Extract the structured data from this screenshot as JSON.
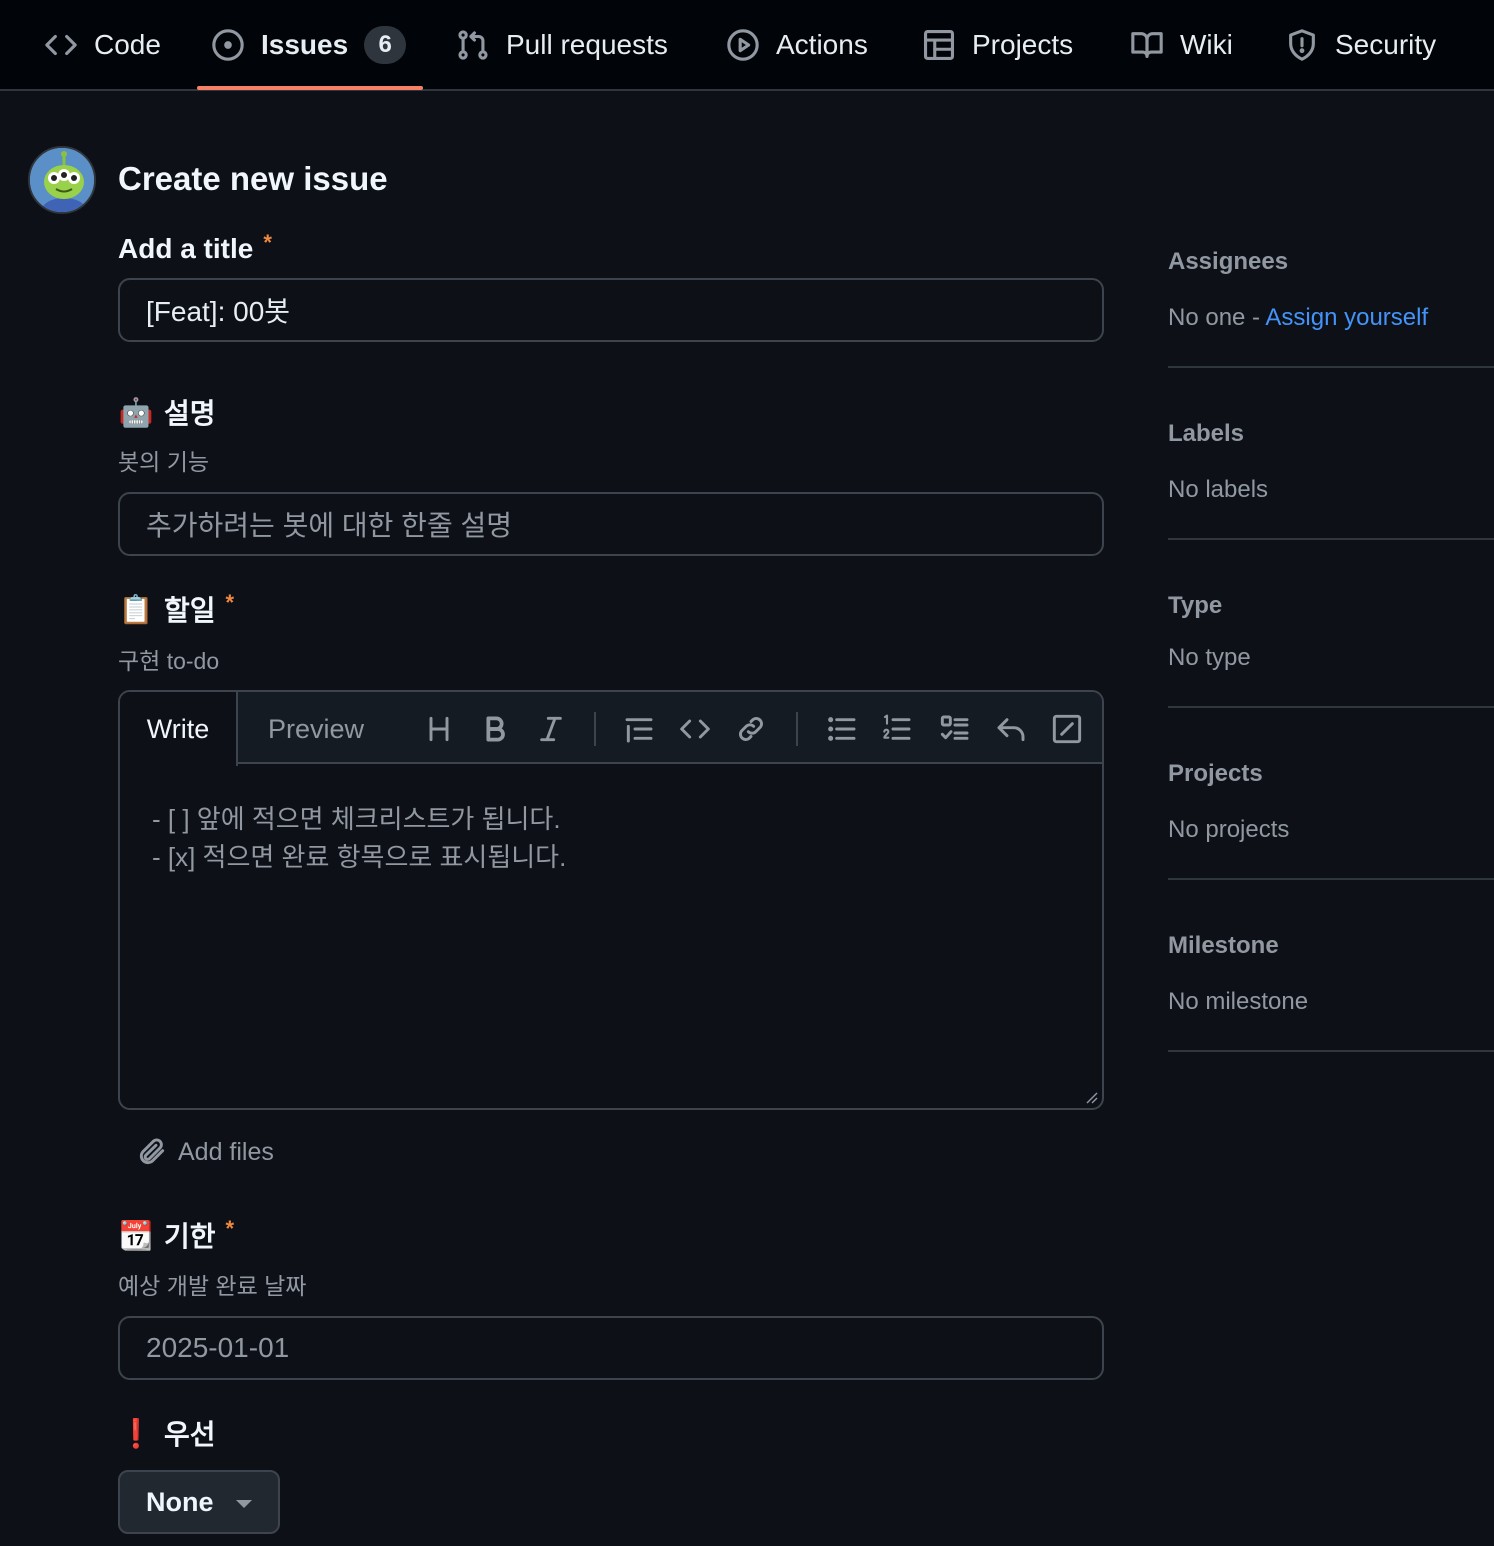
{
  "nav": {
    "tabs": [
      {
        "label": "Code",
        "icon": "code-icon"
      },
      {
        "label": "Issues",
        "icon": "issue-opened-icon",
        "count": "6"
      },
      {
        "label": "Pull requests",
        "icon": "git-pull-request-icon"
      },
      {
        "label": "Actions",
        "icon": "play-icon"
      },
      {
        "label": "Projects",
        "icon": "table-icon"
      },
      {
        "label": "Wiki",
        "icon": "book-icon"
      },
      {
        "label": "Security",
        "icon": "shield-icon"
      }
    ],
    "active_tab": "Issues",
    "active_color": "#f78166"
  },
  "header": {
    "title": "Create new issue"
  },
  "form": {
    "title_field": {
      "label": "Add a title",
      "required_mark": "*",
      "value": "[Feat]: 00봇"
    },
    "description_field": {
      "emoji": "🤖",
      "label": "설명",
      "hint": "봇의 기능",
      "placeholder": "추가하려는 봇에 대한 한줄 설명"
    },
    "todo_field": {
      "emoji": "📋",
      "label": "할일",
      "required_mark": "*",
      "hint": "구현 to-do",
      "write_tab": "Write",
      "preview_tab": "Preview",
      "toolbar_icons": [
        "heading-icon",
        "bold-icon",
        "italic-icon",
        "quote-icon",
        "code-icon",
        "link-icon",
        "unordered-list-icon",
        "ordered-list-icon",
        "tasklist-icon",
        "reply-icon",
        "fullscreen-icon"
      ],
      "placeholder": "- [ ] 앞에 적으면 체크리스트가 됩니다.\n- [x] 적으면 완료 항목으로 표시됩니다.",
      "add_files": "Add files"
    },
    "deadline_field": {
      "emoji": "📆",
      "label": "기한",
      "required_mark": "*",
      "hint": "예상 개발 완료 날짜",
      "placeholder": "2025-01-01"
    },
    "priority_field": {
      "emoji": "❗",
      "label": "우선",
      "selected": "None"
    }
  },
  "sidebar": {
    "assignees": {
      "title": "Assignees",
      "value": "No one - ",
      "link": "Assign yourself"
    },
    "labels": {
      "title": "Labels",
      "value": "No labels"
    },
    "type": {
      "title": "Type",
      "value": "No type"
    },
    "projects": {
      "title": "Projects",
      "value": "No projects"
    },
    "milestone": {
      "title": "Milestone",
      "value": "No milestone"
    }
  },
  "colors": {
    "background": "#0d1117",
    "nav_bg": "#010409",
    "link": "#4493f8",
    "required": "#f0883e",
    "muted": "#9198a1"
  }
}
